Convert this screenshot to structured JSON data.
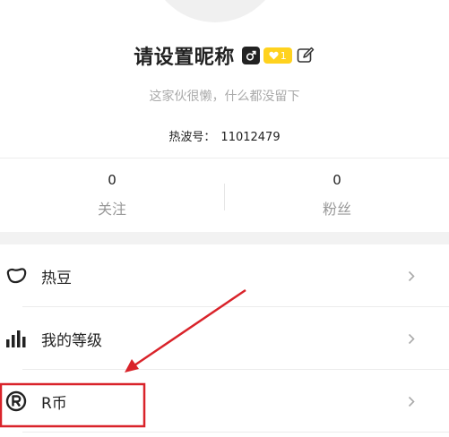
{
  "profile": {
    "nickname": "请设置昵称",
    "level": "1",
    "bio": "这家伙很懒，什么都没留下",
    "hot_id_label": "热波号：",
    "hot_id_value": "11012479"
  },
  "stats": [
    {
      "count": "0",
      "label": "关注"
    },
    {
      "count": "0",
      "label": "粉丝"
    }
  ],
  "menu": [
    {
      "label": "热豆",
      "icon": "bean-icon"
    },
    {
      "label": "我的等级",
      "icon": "bar-chart-icon"
    },
    {
      "label": "R币",
      "icon": "r-coin-icon"
    }
  ],
  "colors": {
    "level_badge": "#ffd21e",
    "annotation_red": "#d9232a",
    "band_gray": "#f2f2f2"
  }
}
